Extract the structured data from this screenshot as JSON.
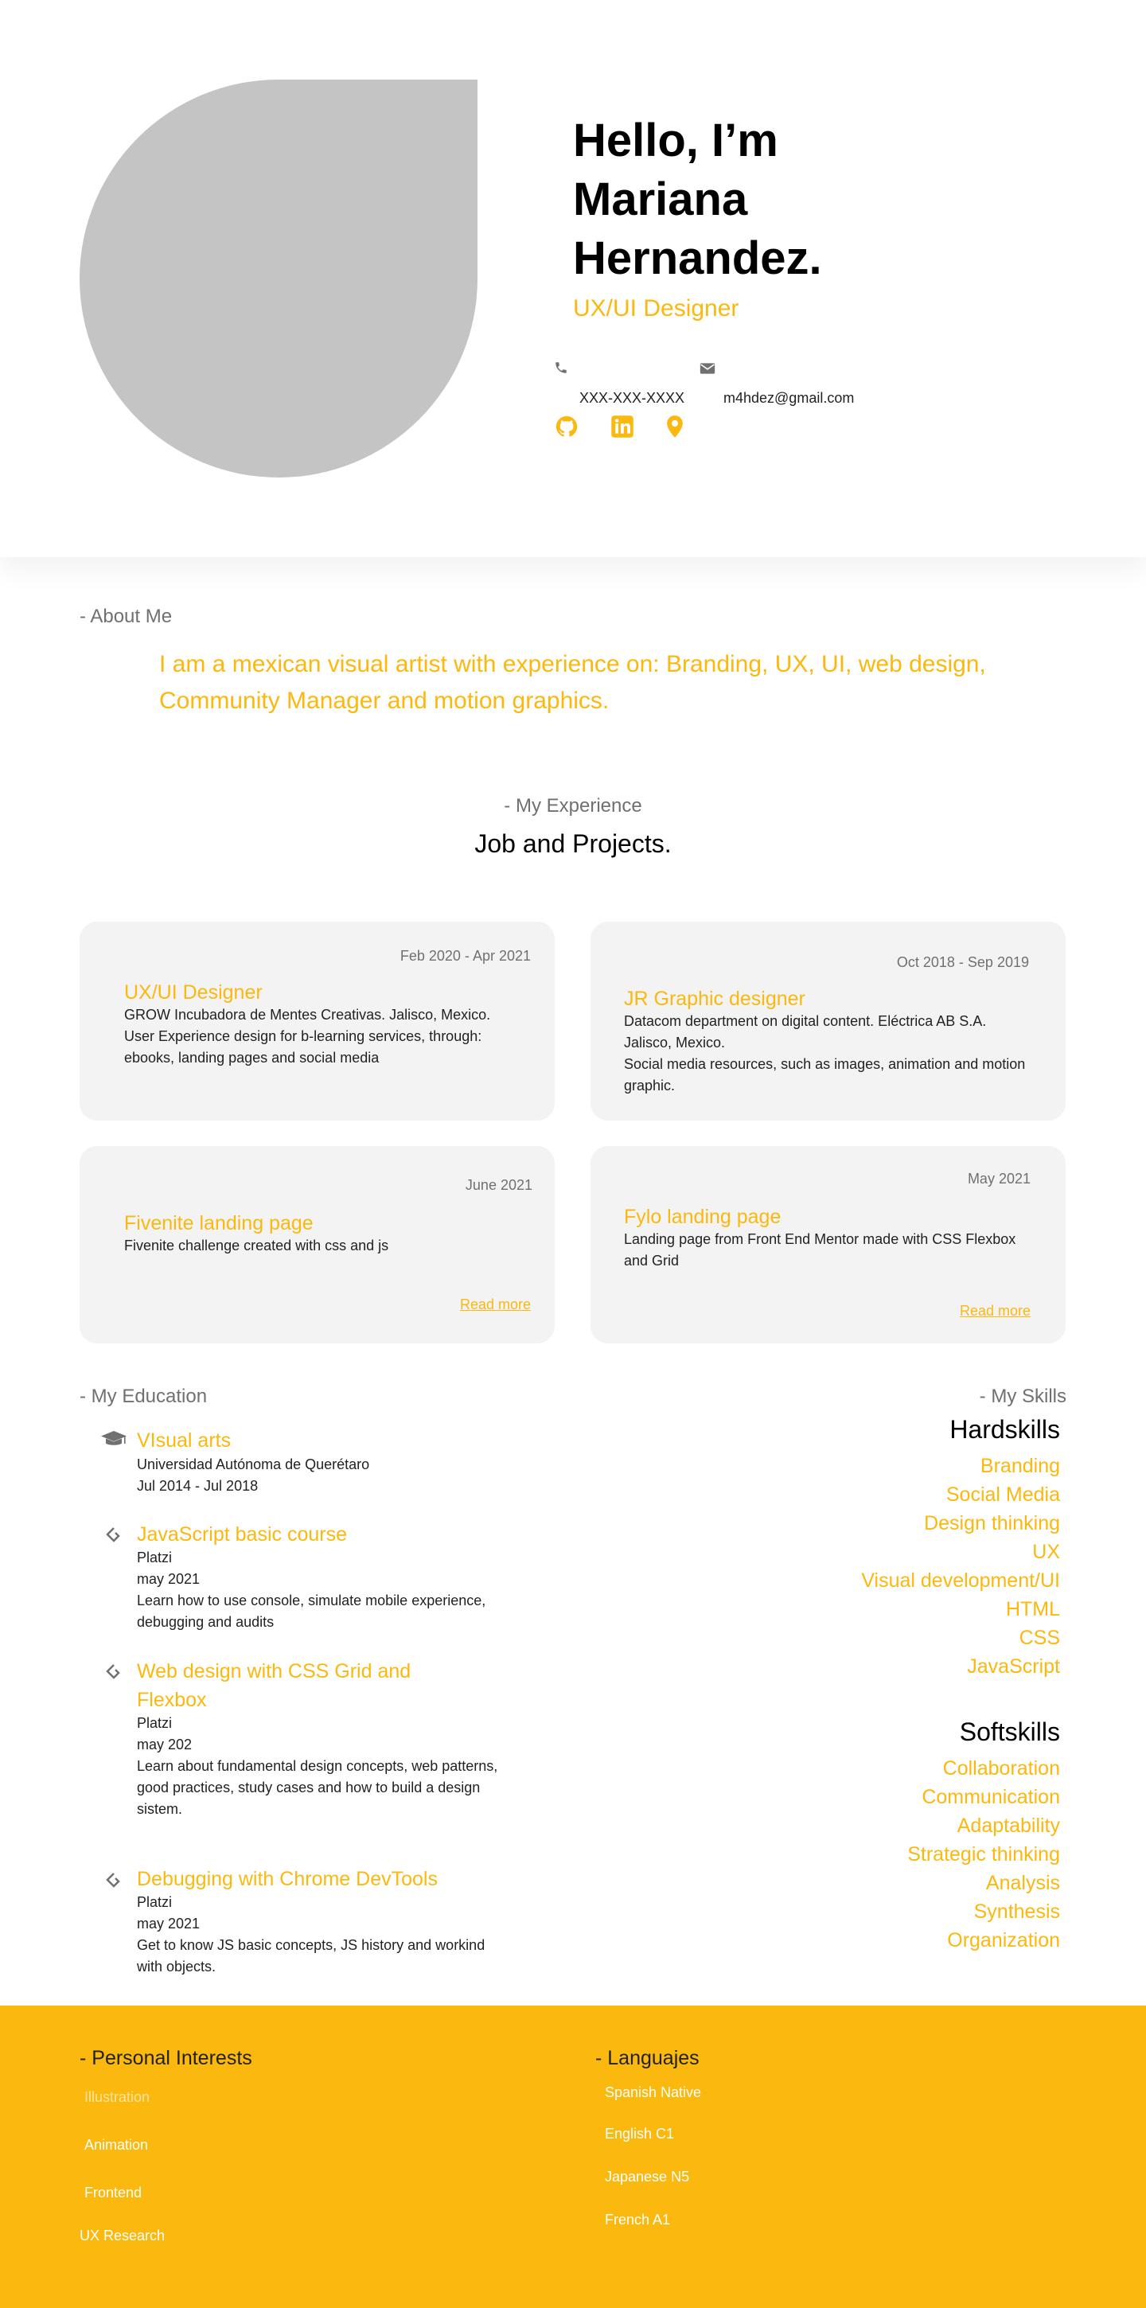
{
  "hero": {
    "greeting_line1": "Hello, I’m",
    "greeting_line2": "Mariana",
    "greeting_line3": "Hernandez.",
    "role": "UX/UI Designer",
    "phone": "XXX-XXX-XXXX",
    "email": "m4hdez@gmail.com",
    "social_icons": [
      "github-icon",
      "linkedin-icon",
      "location-icon"
    ],
    "accent_color": "#FBB80F"
  },
  "about": {
    "label": "- About Me",
    "text": "I am a mexican visual artist with experience on: Branding, UX, UI, web design, Community Manager and motion graphics."
  },
  "experience": {
    "label": "- My Experience",
    "heading": "Job and Projects.",
    "cards": [
      {
        "date": "Feb 2020 - Apr 2021",
        "title": "UX/UI Designer",
        "body": "GROW Incubadora de Mentes Creativas. Jalisco, Mexico. User Experience design for b-learning services, through: ebooks, landing pages and social media"
      },
      {
        "date": "Oct 2018 - Sep 2019",
        "title": "JR Graphic designer",
        "body": "Datacom department on digital content. Eléctrica AB S.A. Jalisco, Mexico.",
        "body2": "Social media resources, such as images, animation and motion graphic."
      },
      {
        "date": "June 2021",
        "title": "Fivenite landing page",
        "body": "Fivenite challenge created with css and js",
        "link": "Read more"
      },
      {
        "date": "May 2021",
        "title": "Fylo landing page",
        "body": "Landing page from Front End Mentor made with CSS Flexbox and Grid",
        "link": "Read more"
      }
    ]
  },
  "education": {
    "label": "- My Education",
    "items": [
      {
        "icon": "graduation-cap-icon",
        "title": "VIsual arts",
        "lines": [
          "Universidad Autónoma de Querétaro",
          "Jul 2014 - Jul 2018"
        ]
      },
      {
        "icon": "course-tag-icon",
        "title": "JavaScript basic course",
        "lines": [
          "Platzi",
          "may 2021",
          "Learn how to use console, simulate mobile experience, debugging and audits"
        ]
      },
      {
        "icon": "course-tag-icon",
        "title": "Web design with CSS Grid and Flexbox",
        "lines": [
          "Platzi",
          "may 202",
          "Learn about fundamental design concepts, web patterns, good practices, study cases and how to build a design sistem."
        ]
      },
      {
        "icon": "course-tag-icon",
        "title": "Debugging with Chrome DevTools",
        "lines": [
          "Platzi",
          "may 2021",
          "Get to know JS basic concepts, JS history and workind with objects."
        ]
      }
    ]
  },
  "skills": {
    "label": "- My Skills",
    "hard_heading": "Hardskills",
    "hard": [
      "Branding",
      "Social Media",
      "Design thinking",
      "UX",
      "Visual development/UI",
      "HTML",
      "CSS",
      "JavaScript"
    ],
    "soft_heading": "Softskills",
    "soft": [
      "Collaboration",
      "Communication",
      "Adaptability",
      "Strategic thinking",
      "Analysis",
      "Synthesis",
      "Organization"
    ]
  },
  "footer": {
    "interests_label": "- Personal Interests",
    "interests": [
      "Illustration",
      "Animation",
      "Frontend",
      "UX Research"
    ],
    "languages_label": "- Languajes",
    "languages": [
      "Spanish Native",
      "English C1",
      "Japanese N5",
      "French A1"
    ]
  }
}
